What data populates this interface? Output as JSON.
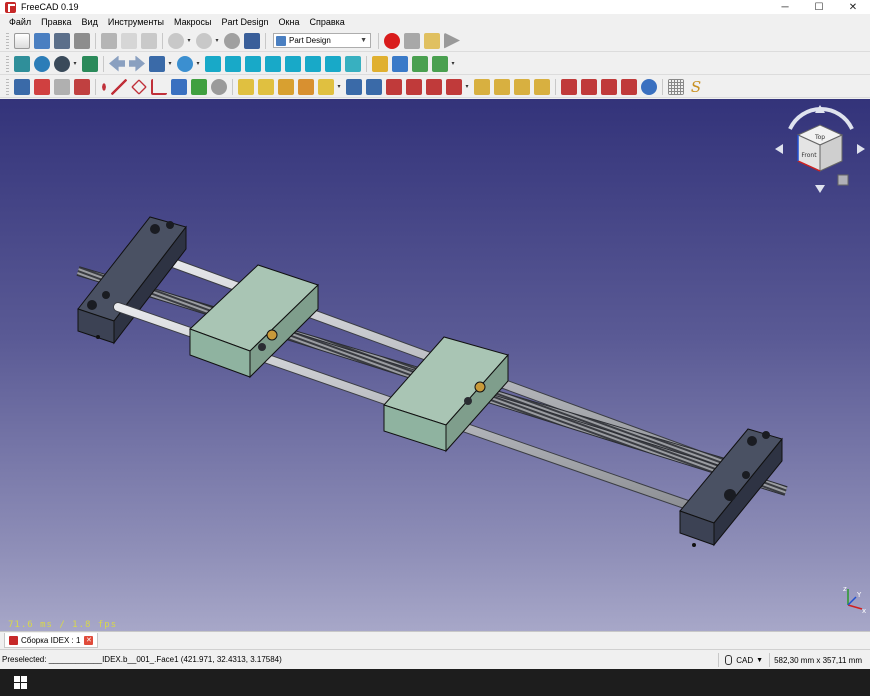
{
  "window": {
    "title": "FreeCAD 0.19",
    "minimize": "─",
    "maximize": "☐",
    "close": "✕"
  },
  "menu": [
    "Файл",
    "Правка",
    "Вид",
    "Инструменты",
    "Макросы",
    "Part Design",
    "Окна",
    "Справка"
  ],
  "workbench": {
    "selected": "Part Design"
  },
  "viewport": {
    "fps": "71.6 ms / 1.8 fps"
  },
  "navcube": {
    "top_label": "Top",
    "front_label": "Front",
    "axis_x": "x",
    "axis_y": "Y",
    "axis_z": "z"
  },
  "tab": {
    "label": "Сборка IDEX : 1"
  },
  "status": {
    "preselected": "Preselected: ____________IDEX.b__001_.Face1 (421.971, 32.4313, 3.17584)",
    "nav_style": "CAD",
    "dimensions": "582,30 mm x 357,11 mm"
  },
  "colors": {
    "viewport_top": "#33337a",
    "viewport_bottom": "#a7a7c8",
    "carriage": "#8fb3a0",
    "end_block": "#343a4a",
    "rod": "#c2c4c8"
  }
}
